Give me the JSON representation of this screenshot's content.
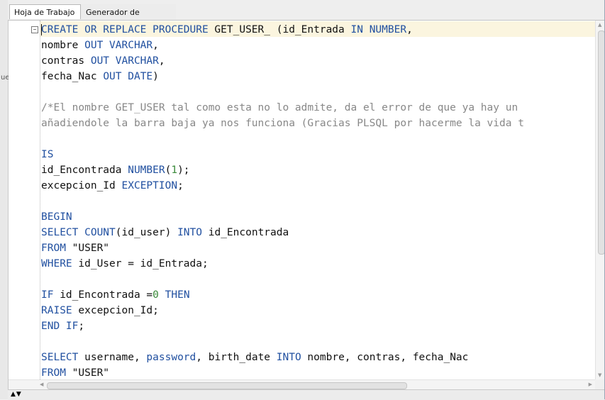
{
  "tabs": [
    {
      "label": "Hoja de Trabajo",
      "active": true
    },
    {
      "label": "Generador de Consultas",
      "active": false
    }
  ],
  "left_strip": {
    "glyph": "ue"
  },
  "editor": {
    "fold_icon": "minus-box-icon",
    "lines": [
      [
        {
          "t": "CREATE OR REPLACE PROCEDURE",
          "c": "k"
        },
        {
          "t": " GET_USER_ (id_Entrada "
        },
        {
          "t": "IN NUMBER",
          "c": "k"
        },
        {
          "t": ","
        }
      ],
      [
        {
          "t": "nombre "
        },
        {
          "t": "OUT VARCHAR",
          "c": "k"
        },
        {
          "t": ","
        }
      ],
      [
        {
          "t": "contras "
        },
        {
          "t": "OUT VARCHAR",
          "c": "k"
        },
        {
          "t": ","
        }
      ],
      [
        {
          "t": "fecha_Nac "
        },
        {
          "t": "OUT DATE",
          "c": "k"
        },
        {
          "t": ")"
        }
      ],
      [],
      [
        {
          "t": "/*El nombre GET_USER tal como esta no lo admite, da el error de que ya hay un",
          "c": "c"
        }
      ],
      [
        {
          "t": "añadiendole la barra baja ya nos funciona (Gracias PLSQL por hacerme la vida t",
          "c": "c"
        }
      ],
      [],
      [
        {
          "t": "IS",
          "c": "k"
        }
      ],
      [
        {
          "t": "id_Encontrada "
        },
        {
          "t": "NUMBER",
          "c": "k"
        },
        {
          "t": "("
        },
        {
          "t": "1",
          "c": "n"
        },
        {
          "t": ");"
        }
      ],
      [
        {
          "t": "excepcion_Id "
        },
        {
          "t": "EXCEPTION",
          "c": "k"
        },
        {
          "t": ";"
        }
      ],
      [],
      [
        {
          "t": "BEGIN",
          "c": "k"
        }
      ],
      [
        {
          "t": "SELECT COUNT",
          "c": "k"
        },
        {
          "t": "(id_user) "
        },
        {
          "t": "INTO",
          "c": "k"
        },
        {
          "t": " id_Encontrada"
        }
      ],
      [
        {
          "t": "FROM",
          "c": "k"
        },
        {
          "t": " \"USER\""
        }
      ],
      [
        {
          "t": "WHERE",
          "c": "k"
        },
        {
          "t": " id_User = id_Entrada;"
        }
      ],
      [],
      [
        {
          "t": "IF",
          "c": "k"
        },
        {
          "t": " id_Encontrada ="
        },
        {
          "t": "0",
          "c": "n"
        },
        {
          "t": " "
        },
        {
          "t": "THEN",
          "c": "k"
        }
      ],
      [
        {
          "t": "RAISE",
          "c": "k"
        },
        {
          "t": " excepcion_Id;"
        }
      ],
      [
        {
          "t": "END IF",
          "c": "k"
        },
        {
          "t": ";"
        }
      ],
      [],
      [
        {
          "t": "SELECT",
          "c": "k"
        },
        {
          "t": " username, "
        },
        {
          "t": "password",
          "c": "k"
        },
        {
          "t": ", birth_date "
        },
        {
          "t": "INTO",
          "c": "k"
        },
        {
          "t": " nombre, contras, fecha_Nac"
        }
      ],
      [
        {
          "t": "FROM",
          "c": "k"
        },
        {
          "t": " \"USER\""
        }
      ]
    ]
  },
  "status": {
    "arrows": "▲▼"
  }
}
